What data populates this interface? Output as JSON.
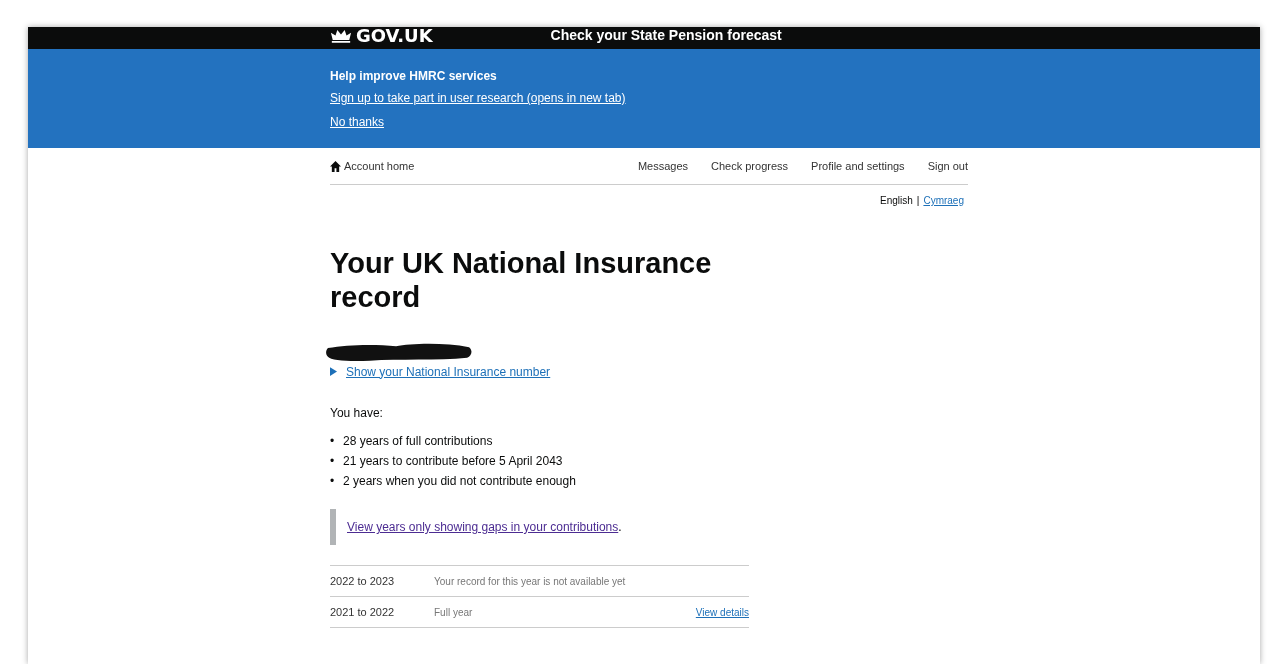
{
  "header": {
    "logo": "GOV.UK",
    "service": "Check your State Pension forecast"
  },
  "banner": {
    "title": "Help improve HMRC services",
    "links": [
      "Sign up to take part in user research (opens in new tab)",
      "No thanks"
    ]
  },
  "nav": {
    "home": "Account home",
    "items": [
      "Messages",
      "Check progress",
      "Profile and settings",
      "Sign out"
    ]
  },
  "language_separator": "|",
  "bullet": "•",
  "languages": [
    {
      "label": "English",
      "selected": true
    },
    {
      "label": "Cymraeg",
      "selected": false
    }
  ],
  "heading": "Your UK National Insurance record",
  "details_toggle": {
    "label": "Show your National Insurance number",
    "expanded": false
  },
  "intro": "You have:",
  "summary": [
    "28 years of full contributions",
    "21 years to contribute before 5 April 2043",
    "2 years when you did not contribute enough"
  ],
  "inset_link": "View years only showing gaps in your contributions",
  "inset_suffix": ".",
  "years": [
    {
      "period": "2022 to 2023",
      "status": "Your record for this year is not available yet"
    },
    {
      "period": "2021 to 2022",
      "status": "Full year",
      "link": "View details"
    }
  ]
}
